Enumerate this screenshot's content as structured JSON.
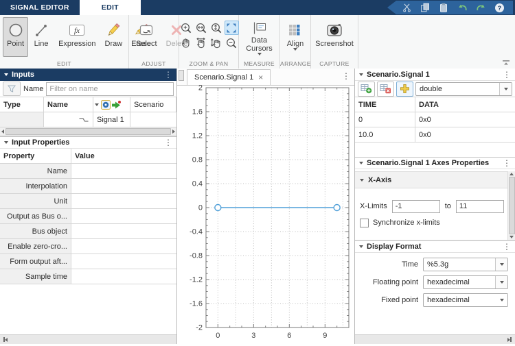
{
  "colors": {
    "navy": "#1b3c63",
    "signal_blue": "#4f9fd8"
  },
  "tabstrip": {
    "signal_editor": "SIGNAL EDITOR",
    "edit": "EDIT"
  },
  "ribbon": {
    "edit": {
      "label": "EDIT",
      "point": "Point",
      "line": "Line",
      "expression": "Expression",
      "draw": "Draw",
      "erase": "Erase"
    },
    "adjust": {
      "label": "ADJUST",
      "select": "Select",
      "delete": "Delete"
    },
    "zoom_pan": {
      "label": "ZOOM & PAN"
    },
    "measure": {
      "label": "MEASURE",
      "data_cursors": "Data Cursors"
    },
    "arrange": {
      "label": "ARRANGE",
      "align": "Align"
    },
    "capture": {
      "label": "CAPTURE",
      "screenshot": "Screenshot"
    }
  },
  "inputs_panel": {
    "title": "Inputs",
    "filter_label": "Name",
    "filter_placeholder": "Filter on name",
    "col_type": "Type",
    "col_name": "Name",
    "col_active": "Active",
    "rows": [
      {
        "name": "Scenario"
      },
      {
        "name": "Signal 1"
      }
    ]
  },
  "input_properties": {
    "title": "Input Properties",
    "col_property": "Property",
    "col_value": "Value",
    "rows": [
      "Name",
      "Interpolation",
      "Unit",
      "Output as Bus o...",
      "Bus object",
      "Enable zero-cro...",
      "Form output aft...",
      "Sample time"
    ]
  },
  "document": {
    "tab_label": "Scenario.Signal 1",
    "close": "×"
  },
  "plot": {
    "x_range": [
      -1,
      11
    ],
    "y_range": [
      -2,
      2
    ],
    "x_ticks": [
      {
        "v": 0,
        "t": "0"
      },
      {
        "v": 3,
        "t": "3"
      },
      {
        "v": 6,
        "t": "6"
      },
      {
        "v": 9,
        "t": "9"
      }
    ],
    "y_ticks": [
      {
        "v": 2,
        "t": "2"
      },
      {
        "v": 1.6,
        "t": "1.6"
      },
      {
        "v": 1.2,
        "t": "1.2"
      },
      {
        "v": 0.8,
        "t": "0.8"
      },
      {
        "v": 0.4,
        "t": "0.4"
      },
      {
        "v": 0,
        "t": "0"
      },
      {
        "v": -0.4,
        "t": "-0.4"
      },
      {
        "v": -0.8,
        "t": "-0.8"
      },
      {
        "v": -1.2,
        "t": "-1.2"
      },
      {
        "v": -1.6,
        "t": "-1.6"
      },
      {
        "v": -2,
        "t": "-2"
      }
    ],
    "x_minor": [
      -1,
      1,
      2,
      4,
      5,
      7,
      8,
      10,
      11
    ],
    "y_minor_step": 0.1,
    "grid_x": [
      0,
      1.5,
      3,
      4.5,
      6,
      7.5,
      9,
      10.5
    ],
    "grid_y": [
      -1.6,
      -1.2,
      -0.8,
      -0.4,
      0,
      0.4,
      0.8,
      1.2,
      1.6
    ],
    "signal": {
      "color": "#4f9fd8",
      "points": [
        [
          0,
          0
        ],
        [
          10,
          0
        ]
      ]
    }
  },
  "signal_panel": {
    "title": "Scenario.Signal 1",
    "datatype": "double",
    "col_time": "TIME",
    "col_data": "DATA",
    "rows": [
      {
        "time": "0",
        "data": "0x0"
      },
      {
        "time": "10.0",
        "data": "0x0"
      }
    ]
  },
  "axes_panel": {
    "title": "Scenario.Signal 1 Axes Properties",
    "x_axis_label": "X-Axis",
    "x_limits_label": "X-Limits",
    "x_min": "-1",
    "to_label": "to",
    "x_max": "11",
    "sync_label": "Synchronize x-limits"
  },
  "display_format": {
    "title": "Display Format",
    "time_label": "Time",
    "time_value": "%5.3g",
    "floating_label": "Floating point",
    "floating_value": "hexadecimal",
    "fixed_label": "Fixed point",
    "fixed_value": "hexadecimal"
  }
}
